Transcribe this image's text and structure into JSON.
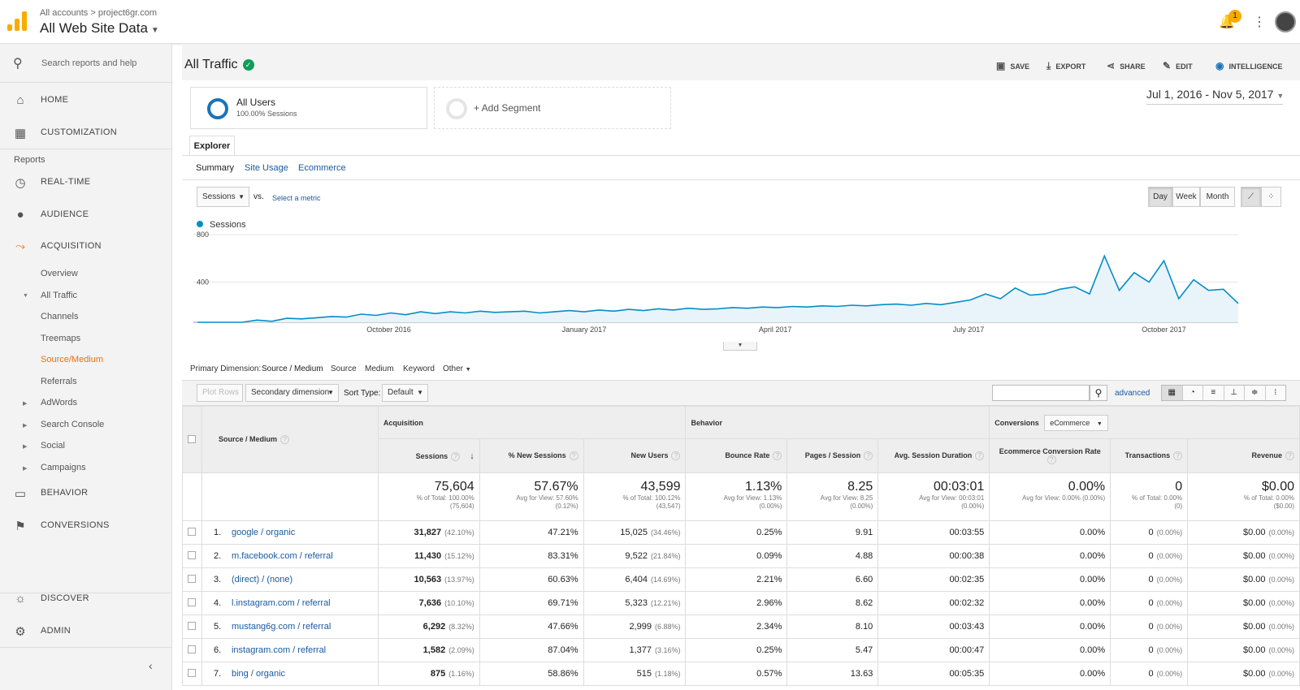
{
  "header": {
    "crumb_accounts": "All accounts",
    "crumb_sep": ">",
    "crumb_property": "project6gr.com",
    "view_name": "All Web Site Data",
    "notification_count": "1"
  },
  "sidebar": {
    "search_placeholder": "Search reports and help",
    "home": "HOME",
    "customization": "CUSTOMIZATION",
    "reports_label": "Reports",
    "realtime": "REAL-TIME",
    "audience": "AUDIENCE",
    "acquisition": "ACQUISITION",
    "overview": "Overview",
    "all_traffic": "All Traffic",
    "channels": "Channels",
    "treemaps": "Treemaps",
    "source_medium": "Source/Medium",
    "referrals": "Referrals",
    "adwords": "AdWords",
    "search_console": "Search Console",
    "social": "Social",
    "campaigns": "Campaigns",
    "behavior": "BEHAVIOR",
    "conversions": "CONVERSIONS",
    "discover": "DISCOVER",
    "admin": "ADMIN"
  },
  "report": {
    "title": "All Traffic",
    "actions": {
      "save": "SAVE",
      "export": "EXPORT",
      "share": "SHARE",
      "edit": "EDIT",
      "intelligence": "INTELLIGENCE"
    },
    "segment_name": "All Users",
    "segment_sub": "100.00% Sessions",
    "add_segment": "+ Add Segment",
    "date_range": "Jul 1, 2016 - Nov 5, 2017",
    "tab_explorer": "Explorer",
    "subtabs": {
      "summary": "Summary",
      "site_usage": "Site Usage",
      "ecommerce": "Ecommerce"
    },
    "metric_select": "Sessions",
    "vs": "vs.",
    "select_metric": "Select a metric",
    "periods": {
      "day": "Day",
      "week": "Week",
      "month": "Month"
    },
    "primary_dimension_label": "Primary Dimension:",
    "dimensions": {
      "source_medium": "Source / Medium",
      "source": "Source",
      "medium": "Medium",
      "keyword": "Keyword",
      "other": "Other"
    },
    "grid": {
      "plot_rows": "Plot Rows",
      "secondary_dimension": "Secondary dimension",
      "sort_type": "Sort Type:",
      "sort_default": "Default",
      "advanced": "advanced"
    }
  },
  "chart_data": {
    "type": "line",
    "series": [
      {
        "name": "Sessions"
      }
    ],
    "x_labels": [
      "October 2016",
      "January 2017",
      "April 2017",
      "July 2017",
      "October 2017"
    ],
    "y_ticks": [
      "800",
      "400"
    ],
    "ylim": [
      0,
      800
    ],
    "grid": true,
    "x_weekly": [
      "2016-07-03",
      "2016-07-10",
      "2016-07-17",
      "2016-07-24",
      "2016-07-31",
      "2016-08-07",
      "2016-08-14",
      "2016-08-21",
      "2016-08-28",
      "2016-09-04",
      "2016-09-11",
      "2016-09-18",
      "2016-09-25",
      "2016-10-02",
      "2016-10-09",
      "2016-10-16",
      "2016-10-23",
      "2016-10-30",
      "2016-11-06",
      "2016-11-13",
      "2016-11-20",
      "2016-11-27",
      "2016-12-04",
      "2016-12-11",
      "2016-12-18",
      "2016-12-25",
      "2017-01-01",
      "2017-01-08",
      "2017-01-15",
      "2017-01-22",
      "2017-01-29",
      "2017-02-05",
      "2017-02-12",
      "2017-02-19",
      "2017-02-26",
      "2017-03-05",
      "2017-03-12",
      "2017-03-19",
      "2017-03-26",
      "2017-04-02",
      "2017-04-09",
      "2017-04-16",
      "2017-04-23",
      "2017-04-30",
      "2017-05-07",
      "2017-05-14",
      "2017-05-21",
      "2017-05-28",
      "2017-06-04",
      "2017-06-11",
      "2017-06-18",
      "2017-06-25",
      "2017-07-02",
      "2017-07-09",
      "2017-07-16",
      "2017-07-23",
      "2017-07-30",
      "2017-08-06",
      "2017-08-13",
      "2017-08-20",
      "2017-08-27",
      "2017-09-03",
      "2017-09-10",
      "2017-09-17",
      "2017-09-24",
      "2017-10-01",
      "2017-10-08",
      "2017-10-15",
      "2017-10-22",
      "2017-10-29",
      "2017-11-05"
    ],
    "y_weekly": [
      5,
      10,
      35,
      60,
      80,
      70,
      95,
      90,
      100,
      110,
      105,
      130,
      120,
      140,
      125,
      150,
      135,
      150,
      140,
      155,
      145,
      150,
      155,
      140,
      150,
      160,
      150,
      165,
      155,
      170,
      160,
      175,
      165,
      180,
      170,
      175,
      185,
      180,
      190,
      185,
      195,
      190,
      200,
      195,
      205,
      200,
      210,
      215,
      205,
      220,
      210,
      230,
      250,
      300,
      260,
      350,
      290,
      300,
      340,
      360,
      300,
      620,
      330,
      480,
      400,
      580,
      260,
      420,
      330,
      340,
      220
    ]
  },
  "table": {
    "headers": {
      "source_medium": "Source / Medium",
      "acquisition": "Acquisition",
      "behavior": "Behavior",
      "conversions": "Conversions",
      "conv_select": "eCommerce",
      "sessions": "Sessions",
      "new_sessions": "% New Sessions",
      "new_users": "New Users",
      "bounce_rate": "Bounce Rate",
      "pages_session": "Pages / Session",
      "avg_duration": "Avg. Session Duration",
      "ecom_rate": "Ecommerce Conversion Rate",
      "transactions": "Transactions",
      "revenue": "Revenue"
    },
    "totals": {
      "sessions": "75,604",
      "sessions_sub1": "% of Total: 100.00%",
      "sessions_sub2": "(75,604)",
      "new_sessions": "57.67%",
      "new_sessions_sub1": "Avg for View: 57.60%",
      "new_sessions_sub2": "(0.12%)",
      "new_users": "43,599",
      "new_users_sub1": "% of Total: 100.12%",
      "new_users_sub2": "(43,547)",
      "bounce": "1.13%",
      "bounce_sub1": "Avg for View: 1.13%",
      "bounce_sub2": "(0.00%)",
      "pages": "8.25",
      "pages_sub1": "Avg for View: 8.25",
      "pages_sub2": "(0.00%)",
      "duration": "00:03:01",
      "duration_sub1": "Avg for View: 00:03:01",
      "duration_sub2": "(0.00%)",
      "ecom": "0.00%",
      "ecom_sub1": "Avg for View: 0.00% (0.00%)",
      "trans": "0",
      "trans_sub1": "% of Total: 0.00%",
      "trans_sub2": "(0)",
      "revenue": "$0.00",
      "revenue_sub1": "% of Total: 0.00%",
      "revenue_sub2": "($0.00)"
    },
    "rows": [
      {
        "n": "1.",
        "src": "google / organic",
        "sessions": "31,827",
        "sp": "(42.10%)",
        "new": "47.21%",
        "users": "15,025",
        "up": "(34.46%)",
        "bounce": "0.25%",
        "pages": "9.91",
        "dur": "00:03:55",
        "ecom": "0.00%",
        "tr": "0",
        "trp": "(0.00%)",
        "rev": "$0.00",
        "revp": "(0.00%)"
      },
      {
        "n": "2.",
        "src": "m.facebook.com / referral",
        "sessions": "11,430",
        "sp": "(15.12%)",
        "new": "83.31%",
        "users": "9,522",
        "up": "(21.84%)",
        "bounce": "0.09%",
        "pages": "4.88",
        "dur": "00:00:38",
        "ecom": "0.00%",
        "tr": "0",
        "trp": "(0.00%)",
        "rev": "$0.00",
        "revp": "(0.00%)"
      },
      {
        "n": "3.",
        "src": "(direct) / (none)",
        "sessions": "10,563",
        "sp": "(13.97%)",
        "new": "60.63%",
        "users": "6,404",
        "up": "(14.69%)",
        "bounce": "2.21%",
        "pages": "6.60",
        "dur": "00:02:35",
        "ecom": "0.00%",
        "tr": "0",
        "trp": "(0.00%)",
        "rev": "$0.00",
        "revp": "(0.00%)"
      },
      {
        "n": "4.",
        "src": "l.instagram.com / referral",
        "sessions": "7,636",
        "sp": "(10.10%)",
        "new": "69.71%",
        "users": "5,323",
        "up": "(12.21%)",
        "bounce": "2.96%",
        "pages": "8.62",
        "dur": "00:02:32",
        "ecom": "0.00%",
        "tr": "0",
        "trp": "(0.00%)",
        "rev": "$0.00",
        "revp": "(0.00%)"
      },
      {
        "n": "5.",
        "src": "mustang6g.com / referral",
        "sessions": "6,292",
        "sp": "(8.32%)",
        "new": "47.66%",
        "users": "2,999",
        "up": "(6.88%)",
        "bounce": "2.34%",
        "pages": "8.10",
        "dur": "00:03:43",
        "ecom": "0.00%",
        "tr": "0",
        "trp": "(0.00%)",
        "rev": "$0.00",
        "revp": "(0.00%)"
      },
      {
        "n": "6.",
        "src": "instagram.com / referral",
        "sessions": "1,582",
        "sp": "(2.09%)",
        "new": "87.04%",
        "users": "1,377",
        "up": "(3.16%)",
        "bounce": "0.25%",
        "pages": "5.47",
        "dur": "00:00:47",
        "ecom": "0.00%",
        "tr": "0",
        "trp": "(0.00%)",
        "rev": "$0.00",
        "revp": "(0.00%)"
      },
      {
        "n": "7.",
        "src": "bing / organic",
        "sessions": "875",
        "sp": "(1.16%)",
        "new": "58.86%",
        "users": "515",
        "up": "(1.18%)",
        "bounce": "0.57%",
        "pages": "13.63",
        "dur": "00:05:35",
        "ecom": "0.00%",
        "tr": "0",
        "trp": "(0.00%)",
        "rev": "$0.00",
        "revp": "(0.00%)"
      }
    ]
  }
}
